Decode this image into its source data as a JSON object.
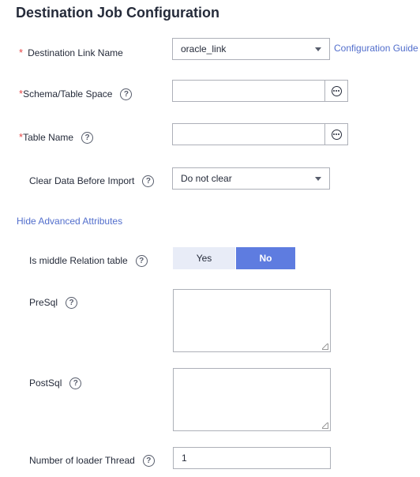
{
  "title": "Destination Job Configuration",
  "fields": {
    "link_name": {
      "required_mark": "*",
      "label": "Destination Link Name",
      "value": "oracle_link"
    },
    "config_guide": "Configuration Guide",
    "schema": {
      "required_mark": "*",
      "label": "Schema/Table Space",
      "help": "?",
      "value": ""
    },
    "table_name": {
      "required_mark": "*",
      "label": "Table Name",
      "help": "?",
      "value": ""
    },
    "clear_data": {
      "label": "Clear Data Before Import",
      "help": "?",
      "value": "Do not clear"
    }
  },
  "advanced_toggle": "Hide Advanced Attributes",
  "advanced": {
    "middle_relation": {
      "label": "Is middle Relation table",
      "help": "?",
      "options": [
        "Yes",
        "No"
      ],
      "selected": "No"
    },
    "presql": {
      "label": "PreSql",
      "help": "?",
      "value": ""
    },
    "postsql": {
      "label": "PostSql",
      "help": "?",
      "value": ""
    },
    "loader_thread": {
      "label": "Number of loader Thread",
      "help": "?",
      "value": "1"
    }
  },
  "colors": {
    "accent": "#526ecc",
    "required": "#e54545",
    "toggle_inactive": "#e8ecf7",
    "border": "#adb0b8"
  },
  "icons": {
    "help": "question-circle-icon",
    "browse": "more-dots-icon",
    "dropdown": "chevron-down-icon"
  }
}
